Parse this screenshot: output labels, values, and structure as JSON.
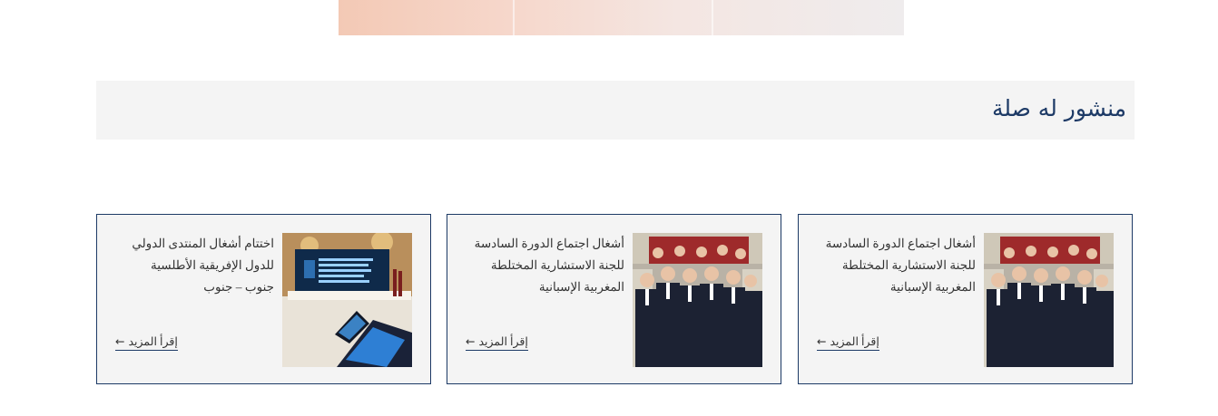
{
  "related": {
    "title": "منشور له صلة",
    "read_more_label": "إقرأ المزيد",
    "read_more_arrow": "←",
    "cards": [
      {
        "title": "أشغال اجتماع الدورة السادسة للجنة الاستشارية المختلطة المغربية الإسبانية",
        "image": "group-photo"
      },
      {
        "title": "أشغال اجتماع الدورة السادسة للجنة الاستشارية المختلطة المغربية الإسبانية",
        "image": "group-photo"
      },
      {
        "title": "اختتام أشغال المنتدى الدولي للدول الإفريقية الأطلسية جنوب – جنوب",
        "image": "conference-hall-photo"
      }
    ]
  }
}
